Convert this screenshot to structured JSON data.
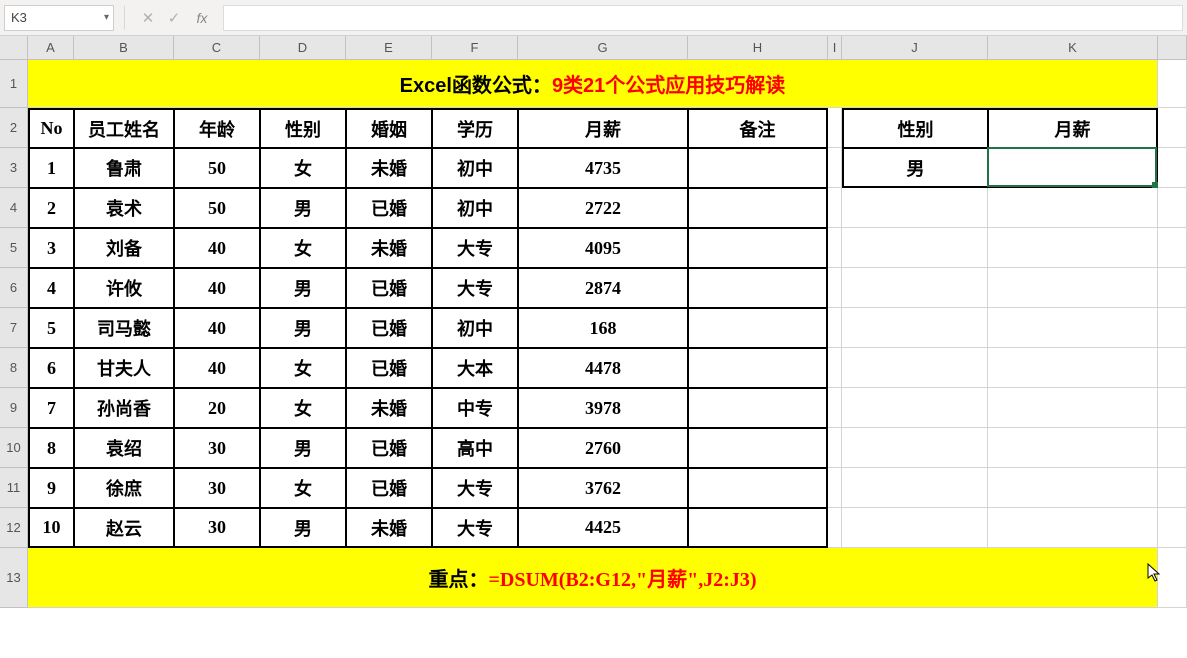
{
  "name_box": "K3",
  "formula_value": "",
  "columns": [
    "A",
    "B",
    "C",
    "D",
    "E",
    "F",
    "G",
    "H",
    "I",
    "J",
    "K"
  ],
  "row_numbers": [
    "1",
    "2",
    "3",
    "4",
    "5",
    "6",
    "7",
    "8",
    "9",
    "10",
    "11",
    "12",
    "13"
  ],
  "title": {
    "part1": "Excel函数公式：",
    "part2": "9类21个公式应用技巧解读"
  },
  "headers": {
    "no": "No",
    "name": "员工姓名",
    "age": "年龄",
    "gender": "性别",
    "marriage": "婚姻",
    "edu": "学历",
    "salary": "月薪",
    "remark": "备注"
  },
  "criteria": {
    "gender_label": "性别",
    "salary_label": "月薪",
    "gender_value": "男",
    "salary_value": ""
  },
  "rows": [
    {
      "no": "1",
      "name": "鲁肃",
      "age": "50",
      "gender": "女",
      "marriage": "未婚",
      "edu": "初中",
      "salary": "4735",
      "remark": ""
    },
    {
      "no": "2",
      "name": "袁术",
      "age": "50",
      "gender": "男",
      "marriage": "已婚",
      "edu": "初中",
      "salary": "2722",
      "remark": ""
    },
    {
      "no": "3",
      "name": "刘备",
      "age": "40",
      "gender": "女",
      "marriage": "未婚",
      "edu": "大专",
      "salary": "4095",
      "remark": ""
    },
    {
      "no": "4",
      "name": "许攸",
      "age": "40",
      "gender": "男",
      "marriage": "已婚",
      "edu": "大专",
      "salary": "2874",
      "remark": ""
    },
    {
      "no": "5",
      "name": "司马懿",
      "age": "40",
      "gender": "男",
      "marriage": "已婚",
      "edu": "初中",
      "salary": "168",
      "remark": ""
    },
    {
      "no": "6",
      "name": "甘夫人",
      "age": "40",
      "gender": "女",
      "marriage": "已婚",
      "edu": "大本",
      "salary": "4478",
      "remark": ""
    },
    {
      "no": "7",
      "name": "孙尚香",
      "age": "20",
      "gender": "女",
      "marriage": "未婚",
      "edu": "中专",
      "salary": "3978",
      "remark": ""
    },
    {
      "no": "8",
      "name": "袁绍",
      "age": "30",
      "gender": "男",
      "marriage": "已婚",
      "edu": "高中",
      "salary": "2760",
      "remark": ""
    },
    {
      "no": "9",
      "name": "徐庶",
      "age": "30",
      "gender": "女",
      "marriage": "已婚",
      "edu": "大专",
      "salary": "3762",
      "remark": ""
    },
    {
      "no": "10",
      "name": "赵云",
      "age": "30",
      "gender": "男",
      "marriage": "未婚",
      "edu": "大专",
      "salary": "4425",
      "remark": ""
    }
  ],
  "footer": {
    "label": "重点：",
    "formula": "=DSUM(B2:G12,\"月薪\",J2:J3)"
  },
  "icons": {
    "cancel": "✕",
    "confirm": "✓",
    "fx": "fx",
    "dropdown": "▾",
    "cursor": "↖"
  }
}
